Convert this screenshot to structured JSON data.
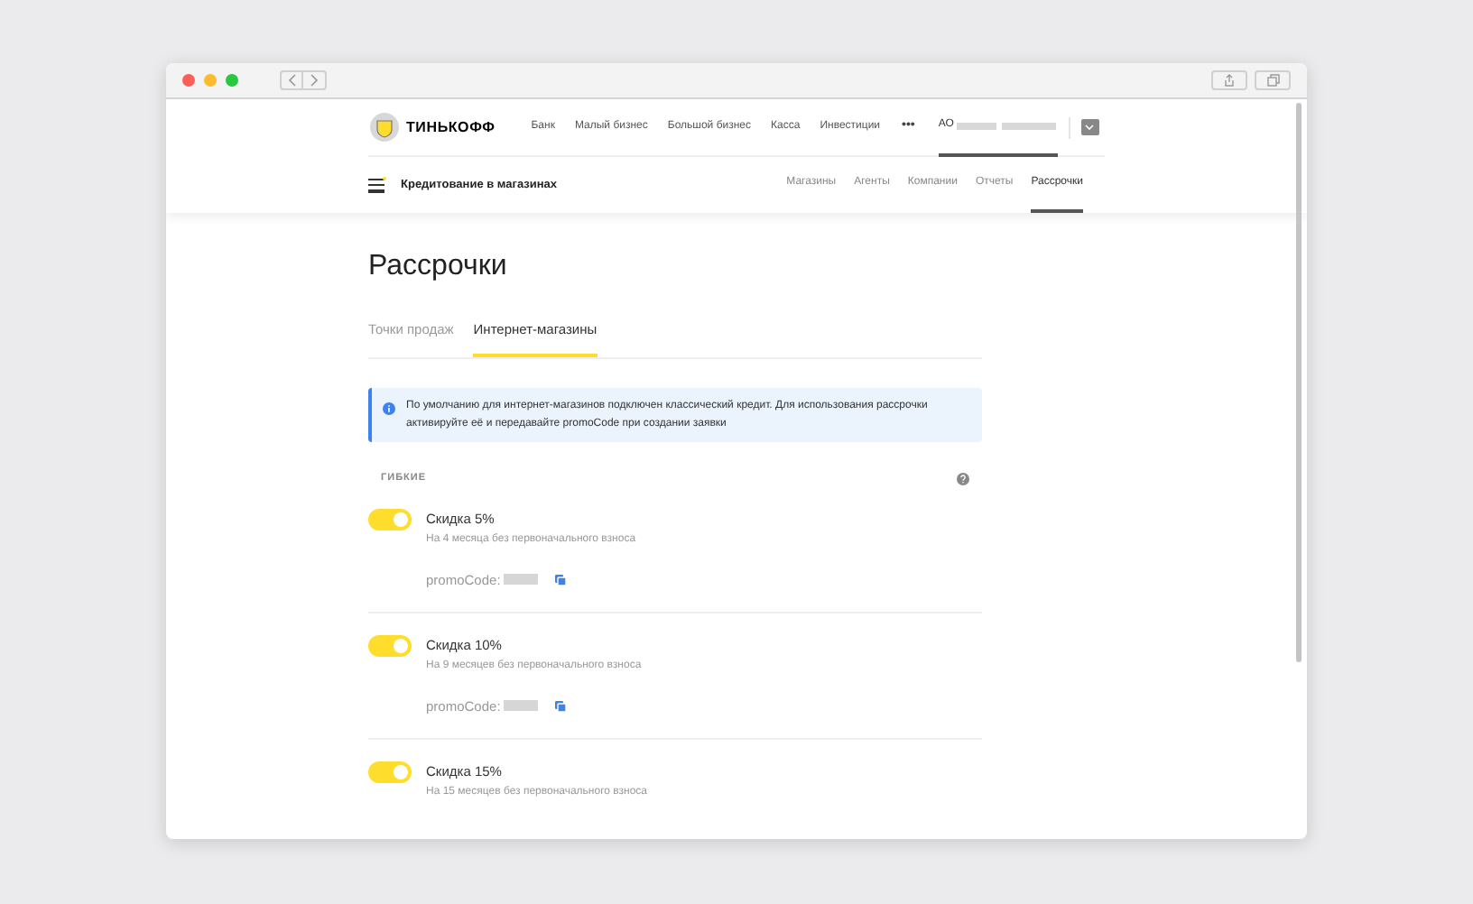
{
  "header": {
    "brand": "ТИНЬКОФФ",
    "nav": [
      {
        "label": "Банк"
      },
      {
        "label": "Малый бизнес"
      },
      {
        "label": "Большой бизнес"
      },
      {
        "label": "Касса"
      },
      {
        "label": "Инвестиции"
      }
    ],
    "more": "•••",
    "account": {
      "prefix": "АО",
      "selected": true
    }
  },
  "subheader": {
    "title": "Кредитование в магазинах",
    "tabs": [
      {
        "label": "Магазины",
        "selected": false
      },
      {
        "label": "Агенты",
        "selected": false
      },
      {
        "label": "Компании",
        "selected": false
      },
      {
        "label": "Отчеты",
        "selected": false
      },
      {
        "label": "Рассрочки",
        "selected": true
      }
    ]
  },
  "page": {
    "title": "Рассрочки",
    "tabs": [
      {
        "label": "Точки продаж",
        "selected": false
      },
      {
        "label": "Интернет-магазины",
        "selected": true
      }
    ],
    "notice": "По умолчанию для интернет-магазинов подключен классический кредит. Для использования рассрочки активируйте её и передавайте promoCode при создании заявки",
    "section": "ГИБКИЕ",
    "plans": [
      {
        "title": "Скидка 5%",
        "subtitle": "На 4 месяца без первоначального взноса",
        "on": true,
        "promo_label": "promoCode:"
      },
      {
        "title": "Скидка 10%",
        "subtitle": "На 9 месяцев без первоначального взноса",
        "on": true,
        "promo_label": "promoCode:"
      },
      {
        "title": "Скидка 15%",
        "subtitle": "На 15 месяцев без первоначального взноса",
        "on": true
      }
    ]
  }
}
